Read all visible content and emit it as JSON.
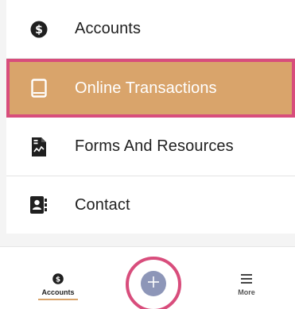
{
  "menu": {
    "items": [
      {
        "label": "Accounts",
        "icon": "dollar-circle-icon"
      },
      {
        "label": "Online Transactions",
        "icon": "tablet-icon"
      },
      {
        "label": "Forms And Resources",
        "icon": "document-chart-icon"
      },
      {
        "label": "Contact",
        "icon": "contact-book-icon"
      }
    ],
    "highlight_color": "#d9a46b",
    "highlight_border_color": "#d84d7c"
  },
  "tabbar": {
    "accounts_label": "Accounts",
    "more_label": "More",
    "fab_icon": "plus-icon",
    "fab_color": "#8d96b8"
  }
}
